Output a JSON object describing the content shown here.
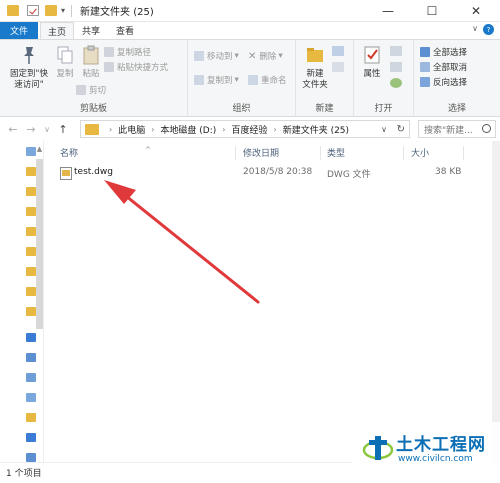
{
  "window": {
    "title": "新建文件夹 (25)",
    "minimize": "—",
    "maximize": "☐",
    "close": "✕"
  },
  "tabs": [
    {
      "label": "文件",
      "active": false
    },
    {
      "label": "主页",
      "active": true
    },
    {
      "label": "共享",
      "active": false
    },
    {
      "label": "查看",
      "active": false
    }
  ],
  "ribbon": {
    "clipboard": {
      "label": "剪贴板",
      "pin": "固定到\"快\n速访问\"",
      "copy": "复制",
      "paste": "粘贴",
      "cut": "剪切",
      "copy_path": "复制路径",
      "paste_shortcut": "粘贴快捷方式"
    },
    "organize": {
      "label": "组织",
      "move_to": "移动到",
      "copy_to": "复制到",
      "delete": "删除",
      "rename": "重命名"
    },
    "new": {
      "label": "新建",
      "new_folder": "新建\n文件夹"
    },
    "open": {
      "label": "打开",
      "properties": "属性"
    },
    "select": {
      "label": "选择",
      "select_all": "全部选择",
      "select_none": "全部取消",
      "invert": "反向选择"
    }
  },
  "address": {
    "crumbs": [
      "此电脑",
      "本地磁盘 (D:)",
      "百度经验",
      "新建文件夹 (25)"
    ],
    "search_placeholder": "搜索\"新建..."
  },
  "columns": {
    "name": "名称",
    "date": "修改日期",
    "type": "类型",
    "size": "大小"
  },
  "files": [
    {
      "name": "test.dwg",
      "date": "2018/5/8 20:38",
      "type": "DWG 文件",
      "size": "38 KB"
    }
  ],
  "status": {
    "count": "1 个项目"
  },
  "watermark": {
    "title": "土木工程网",
    "url": "www.civilcn.com"
  },
  "colors": {
    "accent": "#1979ca",
    "arrow": "#e0393b",
    "folder": "#e8b941"
  }
}
